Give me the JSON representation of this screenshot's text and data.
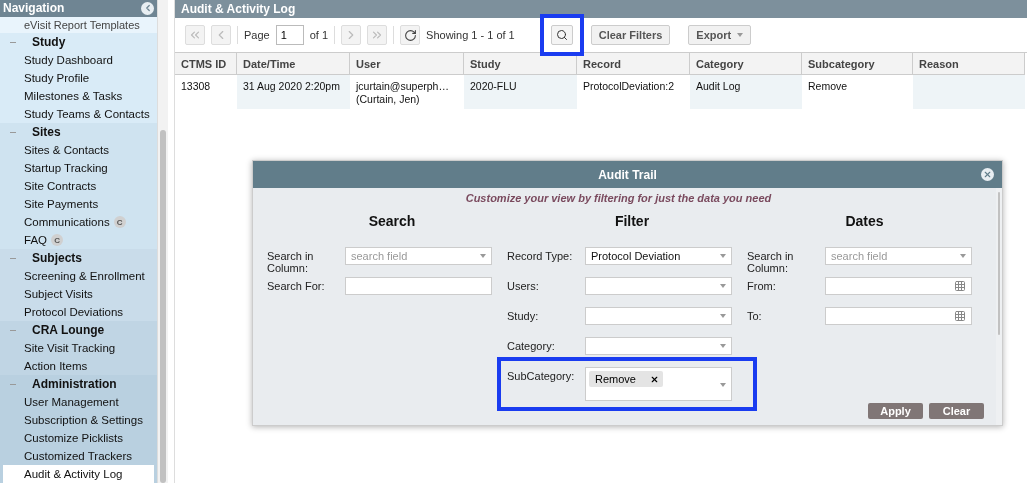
{
  "sidebar": {
    "title": "Navigation",
    "top_item": "eVisit Report Templates",
    "groups": [
      {
        "label": "Study",
        "expanded": true,
        "children": [
          {
            "label": "Study Dashboard",
            "selected": false
          },
          {
            "label": "Study Profile",
            "selected": false
          },
          {
            "label": "Milestones & Tasks",
            "selected": false
          },
          {
            "label": "Study Teams & Contacts",
            "selected": false
          }
        ]
      },
      {
        "label": "Sites",
        "expanded": true,
        "children": [
          {
            "label": "Sites & Contacts",
            "selected": false
          },
          {
            "label": "Startup Tracking",
            "selected": false
          },
          {
            "label": "Site Contracts",
            "selected": false
          },
          {
            "label": "Site Payments",
            "selected": false
          },
          {
            "label": "Communications",
            "badge": "C",
            "selected": false
          },
          {
            "label": "FAQ",
            "badge": "C",
            "selected": false
          }
        ]
      },
      {
        "label": "Subjects",
        "expanded": true,
        "children": [
          {
            "label": "Screening & Enrollment",
            "selected": false
          },
          {
            "label": "Subject Visits",
            "selected": false
          },
          {
            "label": "Protocol Deviations",
            "selected": false
          }
        ]
      },
      {
        "label": "CRA Lounge",
        "expanded": true,
        "children": [
          {
            "label": "Site Visit Tracking",
            "selected": false
          },
          {
            "label": "Action Items",
            "selected": false
          }
        ]
      },
      {
        "label": "Administration",
        "expanded": true,
        "children": [
          {
            "label": "User Management",
            "selected": false
          },
          {
            "label": "Subscription & Settings",
            "selected": false
          },
          {
            "label": "Customize Picklists",
            "selected": false
          },
          {
            "label": "Customized Trackers",
            "selected": false
          },
          {
            "label": "Audit & Activity Log",
            "selected": true
          }
        ]
      }
    ]
  },
  "page": {
    "title": "Audit & Activity Log"
  },
  "toolbar": {
    "nav_before": [
      {
        "kind": "first",
        "disabled": true
      },
      {
        "kind": "prev",
        "disabled": true
      }
    ],
    "page_label": "Page",
    "page_value": "1",
    "page_of": "of 1",
    "nav_after": [
      {
        "kind": "next",
        "disabled": true
      },
      {
        "kind": "last",
        "disabled": true
      }
    ],
    "showing": "Showing 1 - 1 of 1",
    "search_highlighted": true,
    "clear_filters": "Clear Filters",
    "export": "Export"
  },
  "table": {
    "columns": [
      "CTMS ID",
      "Date/Time",
      "User",
      "Study",
      "Record",
      "Category",
      "Subcategory",
      "Reason"
    ],
    "rows": [
      {
        "cells": [
          "13308",
          "31 Aug 2020 2:20pm",
          "jcurtain@superph…\n(Curtain, Jen)",
          "2020-FLU",
          "ProtocolDeviation:2",
          "Audit Log",
          "Remove",
          ""
        ]
      }
    ]
  },
  "dialog": {
    "title": "Audit Trail",
    "subtitle": "Customize your view by filtering for just the data you need",
    "sections": [
      {
        "heading": "Search",
        "fields": [
          {
            "label": "Search in Column:",
            "kind": "select",
            "placeholder": "search field"
          },
          {
            "label": "Search For:",
            "kind": "text"
          }
        ]
      },
      {
        "heading": "Filter",
        "fields": [
          {
            "label": "Record Type:",
            "kind": "select",
            "value": "Protocol Deviation"
          },
          {
            "label": "Users:",
            "kind": "select"
          },
          {
            "label": "Study:",
            "kind": "select"
          },
          {
            "label": "Category:",
            "kind": "select"
          },
          {
            "label": "SubCategory:",
            "kind": "multi",
            "tags": [
              "Remove"
            ],
            "highlighted": true
          }
        ]
      },
      {
        "heading": "Dates",
        "fields": [
          {
            "label": "Search in Column:",
            "kind": "select",
            "placeholder": "search field"
          },
          {
            "label": "From:",
            "kind": "date"
          },
          {
            "label": "To:",
            "kind": "date"
          }
        ]
      }
    ],
    "buttons": [
      "Apply",
      "Clear"
    ]
  }
}
